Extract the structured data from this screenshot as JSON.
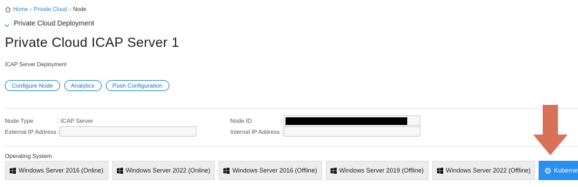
{
  "breadcrumb": {
    "home": "Home",
    "private_cloud": "Private Cloud",
    "current": "Node",
    "separator": "›"
  },
  "section": {
    "label": "Private Cloud Deployment"
  },
  "page": {
    "title": "Private Cloud ICAP Server 1",
    "subtitle": "ICAP Server Deployment"
  },
  "actions": {
    "configure": "Configure Node",
    "analytics": "Analytics",
    "push": "Push Configuration"
  },
  "details": {
    "node_type_label": "Node Type",
    "node_type_value": ": ICAP Server",
    "external_ip_label": "External IP Address :",
    "node_id_label": "Node ID",
    "node_id_colon": ":",
    "internal_ip_label": "Internal IP Address :"
  },
  "os": {
    "label": "Operating System",
    "options": [
      "Windows Server 2016 (Online)",
      "Windows Server 2022 (Online)",
      "Windows Server 2016 (Offline)",
      "Windows Server 2019 (Offline)",
      "Windows Server 2022 (Offline)"
    ],
    "kubernetes": "Kubernetes"
  },
  "colors": {
    "link": "#1f7fcf",
    "accent": "#2b8ff0",
    "arrow": "#d9705a"
  }
}
